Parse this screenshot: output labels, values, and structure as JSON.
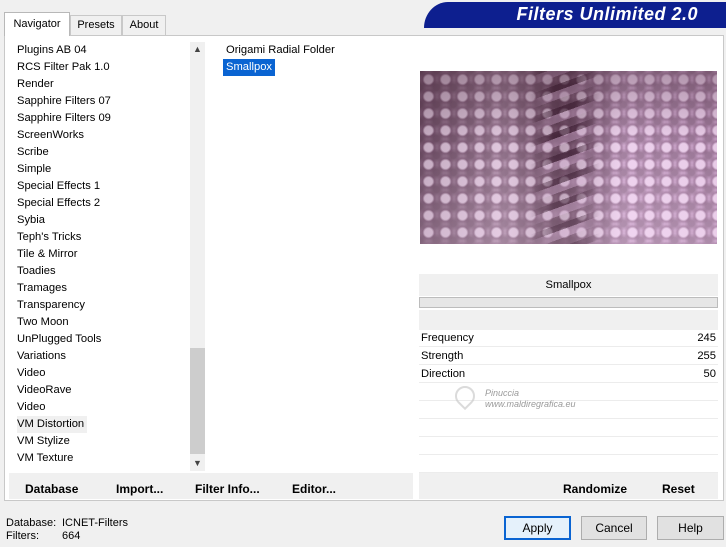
{
  "tabs": [
    {
      "label": "Navigator"
    },
    {
      "label": "Presets"
    },
    {
      "label": "About"
    }
  ],
  "banner_title": "Filters Unlimited 2.0",
  "categories": [
    "Plugins AB 04",
    "RCS Filter Pak 1.0",
    "Render",
    "Sapphire Filters 07",
    "Sapphire Filters 09",
    "ScreenWorks",
    "Scribe",
    "Simple",
    "Special Effects 1",
    "Special Effects 2",
    "Sybia",
    "Teph's Tricks",
    "Tile & Mirror",
    "Toadies",
    "Tramages",
    "Transparency",
    "Two Moon",
    "UnPlugged Tools",
    "Variations",
    "Video",
    "VideoRave",
    "Video",
    "VM Distortion",
    "VM Stylize",
    "VM Texture"
  ],
  "filters": [
    "Origami Radial Folder",
    "Smallpox"
  ],
  "selected_filter_name": "Smallpox",
  "parameters": [
    {
      "label": "Frequency",
      "value": "245"
    },
    {
      "label": "Strength",
      "value": "255"
    },
    {
      "label": "Direction",
      "value": "50"
    }
  ],
  "watermark": {
    "line1": "Pinuccia",
    "line2": "www.maldiregrafica.eu"
  },
  "bottom_links": {
    "database": "Database",
    "import": "Import...",
    "filter_info": "Filter Info...",
    "editor": "Editor...",
    "randomize": "Randomize",
    "reset": "Reset"
  },
  "footer": {
    "database_label": "Database:",
    "database_value": "ICNET-Filters",
    "filters_label": "Filters:",
    "filters_value": "664"
  },
  "buttons": {
    "apply": "Apply",
    "cancel": "Cancel",
    "help": "Help"
  }
}
